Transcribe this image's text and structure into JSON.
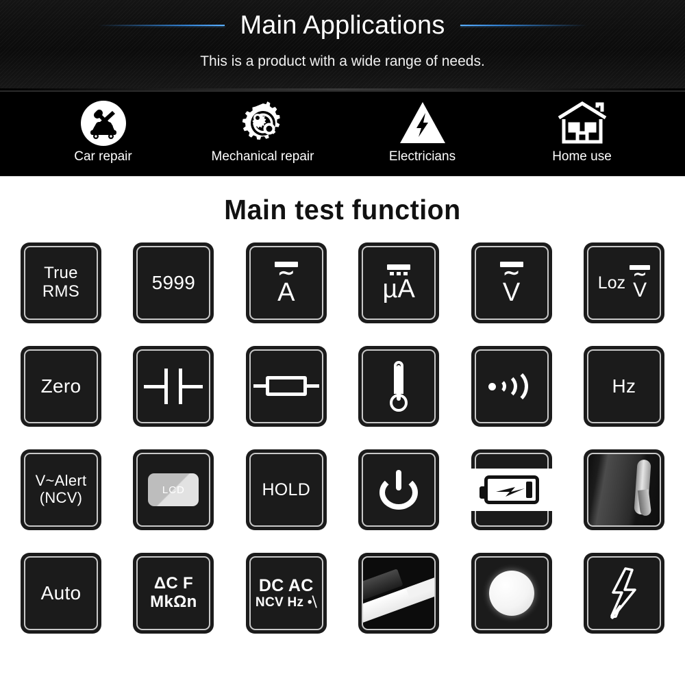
{
  "header": {
    "title": "Main Applications",
    "subtitle": "This is a product with a wide range of needs.",
    "accent_color": "#3487dc",
    "background_color": "#0b0b0b",
    "left_rule": "divider-line-left",
    "right_rule": "divider-line-right"
  },
  "applications": [
    {
      "label": "Car repair",
      "icon": "car-repair-icon"
    },
    {
      "label": "Mechanical repair",
      "icon": "gear-cluster-icon"
    },
    {
      "label": "Electricians",
      "icon": "high-voltage-triangle-icon"
    },
    {
      "label": "Home use",
      "icon": "house-icon"
    }
  ],
  "section": {
    "title": "Main test function"
  },
  "tiles": [
    {
      "id": "true-rms",
      "type": "text",
      "line1": "True",
      "line2": "RMS"
    },
    {
      "id": "counts",
      "type": "text",
      "line1": "5999"
    },
    {
      "id": "ac-dc-amp",
      "type": "glyph",
      "glyph": "ac-dc-current-icon",
      "letter": "A"
    },
    {
      "id": "dc-microamp",
      "type": "glyph",
      "glyph": "dc-microamp-icon",
      "letter": "µA"
    },
    {
      "id": "ac-dc-volt",
      "type": "glyph",
      "glyph": "ac-dc-voltage-icon",
      "letter": "V"
    },
    {
      "id": "loz-volt",
      "type": "glyph",
      "glyph": "low-impedance-voltage-icon",
      "prefix": "Loz",
      "letter": "V"
    },
    {
      "id": "zero",
      "type": "text",
      "line1": "Zero"
    },
    {
      "id": "capacitance",
      "type": "glyph",
      "glyph": "capacitor-icon"
    },
    {
      "id": "resistance",
      "type": "glyph",
      "glyph": "resistor-icon"
    },
    {
      "id": "temperature",
      "type": "glyph",
      "glyph": "thermometer-icon"
    },
    {
      "id": "continuity",
      "type": "glyph",
      "glyph": "continuity-buzzer-icon"
    },
    {
      "id": "frequency",
      "type": "text",
      "line1": "Hz"
    },
    {
      "id": "ncv-alert",
      "type": "text",
      "line1": "V~Alert",
      "line2": "(NCV)"
    },
    {
      "id": "lcd-backlight",
      "type": "glyph",
      "glyph": "lcd-backlight-icon",
      "caption": "LCD"
    },
    {
      "id": "data-hold",
      "type": "text",
      "line1": "HOLD"
    },
    {
      "id": "power",
      "type": "glyph",
      "glyph": "power-button-icon"
    },
    {
      "id": "low-battery",
      "type": "glyph",
      "glyph": "battery-low-icon"
    },
    {
      "id": "magnet-hanger",
      "type": "photo",
      "glyph": "magnet-hanger-photo"
    },
    {
      "id": "auto-range",
      "type": "text",
      "line1": "Auto"
    },
    {
      "id": "units",
      "type": "text",
      "line1": "ΔC F",
      "line2": "MkΩn"
    },
    {
      "id": "modes",
      "type": "text",
      "line1": "DC AC",
      "line2": "NCV Hz •⧹"
    },
    {
      "id": "test-probe",
      "type": "photo",
      "glyph": "test-probe-photo"
    },
    {
      "id": "flashlight",
      "type": "glyph",
      "glyph": "flashlight-icon"
    },
    {
      "id": "high-voltage",
      "type": "glyph",
      "glyph": "high-voltage-bolt-icon"
    }
  ]
}
